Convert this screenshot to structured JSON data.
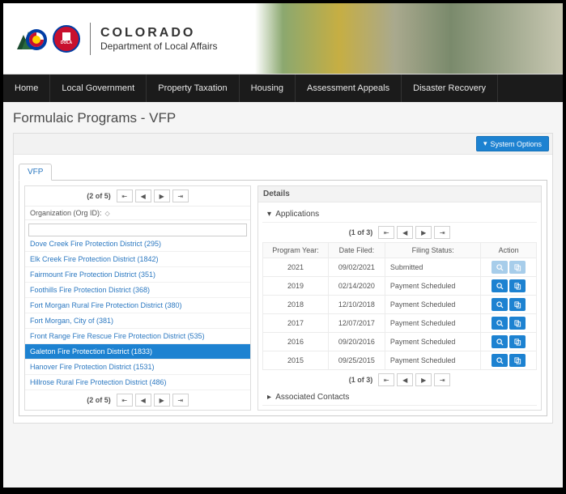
{
  "brand": {
    "name": "COLORADO",
    "dept": "Department of Local Affairs",
    "dola_label": "DOLA"
  },
  "nav": [
    "Home",
    "Local Government",
    "Property Taxation",
    "Housing",
    "Assessment Appeals",
    "Disaster Recovery"
  ],
  "page_title": "Formulaic Programs - VFP",
  "system_options_label": "System Options",
  "tab_label": "VFP",
  "left_pager": {
    "label": "(2 of 5)"
  },
  "org_header": "Organization (Org ID):",
  "org_filter_value": "",
  "org_list": [
    "Dove Creek Fire Protection District (295)",
    "Elk Creek Fire Protection District (1842)",
    "Fairmount Fire Protection District (351)",
    "Foothills Fire Protection District (368)",
    "Fort Morgan Rural Fire Protection District (380)",
    "Fort Morgan, City of (381)",
    "Front Range Fire Rescue Fire Protection District (535)",
    "Galeton Fire Protection District (1833)",
    "Hanover Fire Protection District (1531)",
    "Hillrose Rural Fire Protection District (486)"
  ],
  "org_selected_index": 7,
  "details_label": "Details",
  "applications_label": "Applications",
  "apps_pager": {
    "label": "(1 of 3)"
  },
  "app_columns": {
    "year": "Program Year:",
    "date": "Date Filed:",
    "status": "Filing Status:",
    "action": "Action"
  },
  "apps": [
    {
      "year": "2021",
      "date": "09/02/2021",
      "status": "Submitted",
      "light": true
    },
    {
      "year": "2019",
      "date": "02/14/2020",
      "status": "Payment Scheduled",
      "light": false
    },
    {
      "year": "2018",
      "date": "12/10/2018",
      "status": "Payment Scheduled",
      "light": false
    },
    {
      "year": "2017",
      "date": "12/07/2017",
      "status": "Payment Scheduled",
      "light": false
    },
    {
      "year": "2016",
      "date": "09/20/2016",
      "status": "Payment Scheduled",
      "light": false
    },
    {
      "year": "2015",
      "date": "09/25/2015",
      "status": "Payment Scheduled",
      "light": false
    }
  ],
  "associated_contacts_label": "Associated Contacts",
  "pager_icons": {
    "first": "⇤",
    "prev": "◀",
    "next": "▶",
    "last": "⇥"
  }
}
